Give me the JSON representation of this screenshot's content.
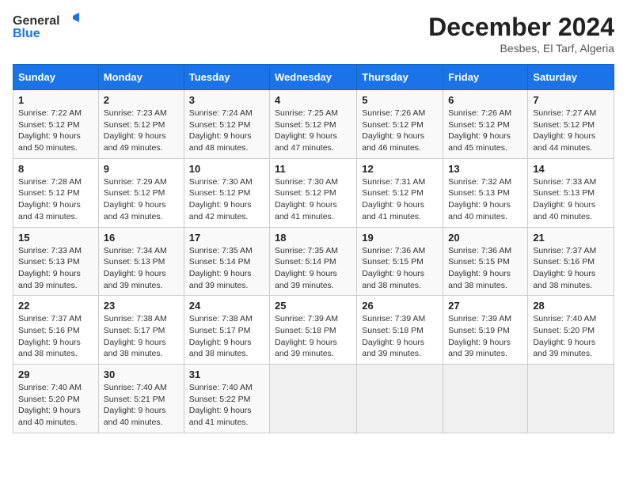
{
  "header": {
    "logo_line1": "General",
    "logo_line2": "Blue",
    "month_title": "December 2024",
    "location": "Besbes, El Tarf, Algeria"
  },
  "weekdays": [
    "Sunday",
    "Monday",
    "Tuesday",
    "Wednesday",
    "Thursday",
    "Friday",
    "Saturday"
  ],
  "weeks": [
    [
      {
        "day": 1,
        "info": "Sunrise: 7:22 AM\nSunset: 5:12 PM\nDaylight: 9 hours\nand 50 minutes."
      },
      {
        "day": 2,
        "info": "Sunrise: 7:23 AM\nSunset: 5:12 PM\nDaylight: 9 hours\nand 49 minutes."
      },
      {
        "day": 3,
        "info": "Sunrise: 7:24 AM\nSunset: 5:12 PM\nDaylight: 9 hours\nand 48 minutes."
      },
      {
        "day": 4,
        "info": "Sunrise: 7:25 AM\nSunset: 5:12 PM\nDaylight: 9 hours\nand 47 minutes."
      },
      {
        "day": 5,
        "info": "Sunrise: 7:26 AM\nSunset: 5:12 PM\nDaylight: 9 hours\nand 46 minutes."
      },
      {
        "day": 6,
        "info": "Sunrise: 7:26 AM\nSunset: 5:12 PM\nDaylight: 9 hours\nand 45 minutes."
      },
      {
        "day": 7,
        "info": "Sunrise: 7:27 AM\nSunset: 5:12 PM\nDaylight: 9 hours\nand 44 minutes."
      }
    ],
    [
      {
        "day": 8,
        "info": "Sunrise: 7:28 AM\nSunset: 5:12 PM\nDaylight: 9 hours\nand 43 minutes."
      },
      {
        "day": 9,
        "info": "Sunrise: 7:29 AM\nSunset: 5:12 PM\nDaylight: 9 hours\nand 43 minutes."
      },
      {
        "day": 10,
        "info": "Sunrise: 7:30 AM\nSunset: 5:12 PM\nDaylight: 9 hours\nand 42 minutes."
      },
      {
        "day": 11,
        "info": "Sunrise: 7:30 AM\nSunset: 5:12 PM\nDaylight: 9 hours\nand 41 minutes."
      },
      {
        "day": 12,
        "info": "Sunrise: 7:31 AM\nSunset: 5:12 PM\nDaylight: 9 hours\nand 41 minutes."
      },
      {
        "day": 13,
        "info": "Sunrise: 7:32 AM\nSunset: 5:13 PM\nDaylight: 9 hours\nand 40 minutes."
      },
      {
        "day": 14,
        "info": "Sunrise: 7:33 AM\nSunset: 5:13 PM\nDaylight: 9 hours\nand 40 minutes."
      }
    ],
    [
      {
        "day": 15,
        "info": "Sunrise: 7:33 AM\nSunset: 5:13 PM\nDaylight: 9 hours\nand 39 minutes."
      },
      {
        "day": 16,
        "info": "Sunrise: 7:34 AM\nSunset: 5:13 PM\nDaylight: 9 hours\nand 39 minutes."
      },
      {
        "day": 17,
        "info": "Sunrise: 7:35 AM\nSunset: 5:14 PM\nDaylight: 9 hours\nand 39 minutes."
      },
      {
        "day": 18,
        "info": "Sunrise: 7:35 AM\nSunset: 5:14 PM\nDaylight: 9 hours\nand 39 minutes."
      },
      {
        "day": 19,
        "info": "Sunrise: 7:36 AM\nSunset: 5:15 PM\nDaylight: 9 hours\nand 38 minutes."
      },
      {
        "day": 20,
        "info": "Sunrise: 7:36 AM\nSunset: 5:15 PM\nDaylight: 9 hours\nand 38 minutes."
      },
      {
        "day": 21,
        "info": "Sunrise: 7:37 AM\nSunset: 5:16 PM\nDaylight: 9 hours\nand 38 minutes."
      }
    ],
    [
      {
        "day": 22,
        "info": "Sunrise: 7:37 AM\nSunset: 5:16 PM\nDaylight: 9 hours\nand 38 minutes."
      },
      {
        "day": 23,
        "info": "Sunrise: 7:38 AM\nSunset: 5:17 PM\nDaylight: 9 hours\nand 38 minutes."
      },
      {
        "day": 24,
        "info": "Sunrise: 7:38 AM\nSunset: 5:17 PM\nDaylight: 9 hours\nand 38 minutes."
      },
      {
        "day": 25,
        "info": "Sunrise: 7:39 AM\nSunset: 5:18 PM\nDaylight: 9 hours\nand 39 minutes."
      },
      {
        "day": 26,
        "info": "Sunrise: 7:39 AM\nSunset: 5:18 PM\nDaylight: 9 hours\nand 39 minutes."
      },
      {
        "day": 27,
        "info": "Sunrise: 7:39 AM\nSunset: 5:19 PM\nDaylight: 9 hours\nand 39 minutes."
      },
      {
        "day": 28,
        "info": "Sunrise: 7:40 AM\nSunset: 5:20 PM\nDaylight: 9 hours\nand 39 minutes."
      }
    ],
    [
      {
        "day": 29,
        "info": "Sunrise: 7:40 AM\nSunset: 5:20 PM\nDaylight: 9 hours\nand 40 minutes."
      },
      {
        "day": 30,
        "info": "Sunrise: 7:40 AM\nSunset: 5:21 PM\nDaylight: 9 hours\nand 40 minutes."
      },
      {
        "day": 31,
        "info": "Sunrise: 7:40 AM\nSunset: 5:22 PM\nDaylight: 9 hours\nand 41 minutes."
      },
      null,
      null,
      null,
      null
    ]
  ]
}
